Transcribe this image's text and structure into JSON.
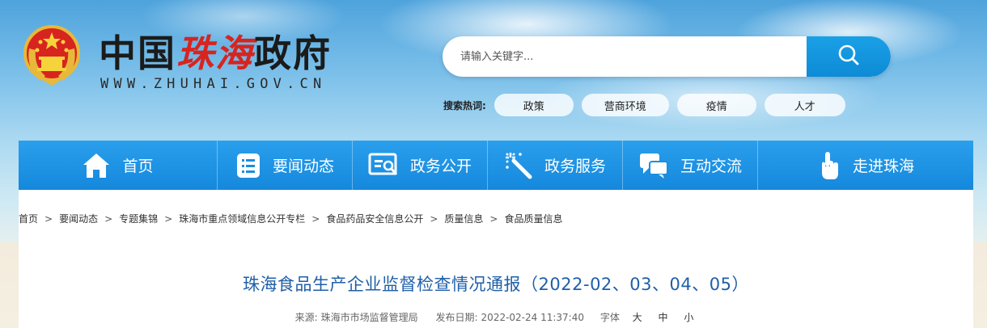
{
  "header": {
    "title_part1": "中国",
    "title_part2": "珠海",
    "title_part3": "政府",
    "url": "WWW.ZHUHAI.GOV.CN"
  },
  "search": {
    "placeholder": "请输入关键字..."
  },
  "hot_search": {
    "label": "搜索热词:",
    "tags": [
      "政策",
      "营商环境",
      "疫情",
      "人才"
    ]
  },
  "nav": {
    "items": [
      {
        "label": "首页",
        "icon": "home-icon"
      },
      {
        "label": "要闻动态",
        "icon": "list-icon"
      },
      {
        "label": "政务公开",
        "icon": "document-search-icon"
      },
      {
        "label": "政务服务",
        "icon": "magic-wand-icon"
      },
      {
        "label": "互动交流",
        "icon": "chat-icon"
      },
      {
        "label": "走进珠海",
        "icon": "pointer-hand-icon"
      }
    ]
  },
  "breadcrumb": [
    "首页",
    "要闻动态",
    "专题集锦",
    "珠海市重点领域信息公开专栏",
    "食品药品安全信息公开",
    "质量信息",
    "食品质量信息"
  ],
  "article": {
    "title": "珠海食品生产企业监督检查情况通报（2022-02、03、04、05）",
    "source_label": "来源:",
    "source": "珠海市市场监督管理局",
    "date_label": "发布日期:",
    "date": "2022-02-24 11:37:40",
    "font_label": "字体",
    "font_large": "大",
    "font_medium": "中",
    "font_small": "小"
  },
  "colors": {
    "nav_blue": "#1a8fe0",
    "title_blue": "#1f5fa8",
    "accent_red": "#d8241f"
  }
}
